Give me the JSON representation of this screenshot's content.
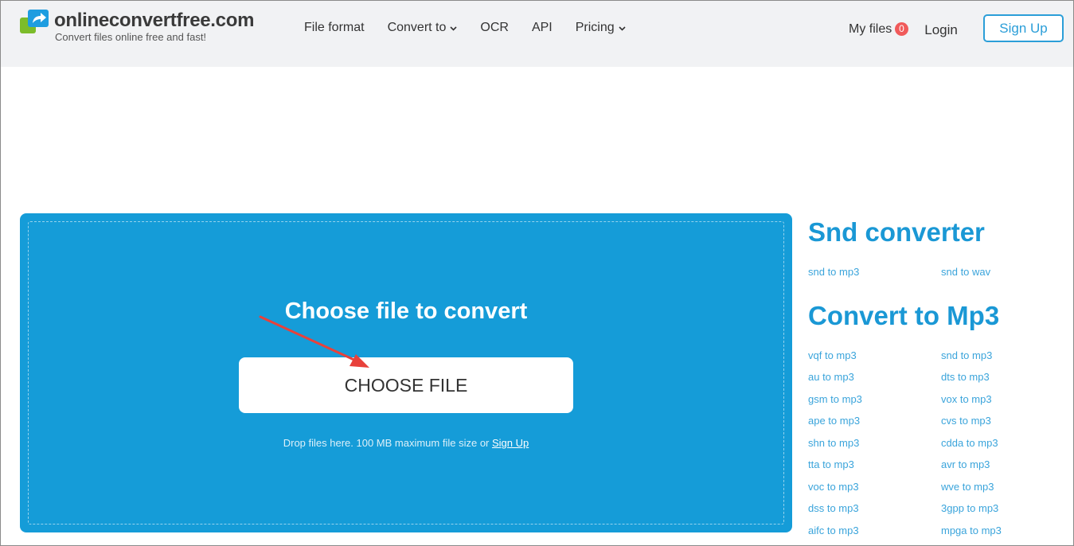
{
  "header": {
    "logo_title": "onlineconvertfree.com",
    "logo_subtitle": "Convert files online free and fast!",
    "nav": [
      {
        "label": "File format",
        "dropdown": false
      },
      {
        "label": "Convert to",
        "dropdown": true
      },
      {
        "label": "OCR",
        "dropdown": false
      },
      {
        "label": "API",
        "dropdown": false
      },
      {
        "label": "Pricing",
        "dropdown": true
      }
    ],
    "my_files_label": "My files",
    "my_files_count": "0",
    "login_label": "Login",
    "signup_label": "Sign Up"
  },
  "upload": {
    "title": "Choose file to convert",
    "button_label": "CHOOSE FILE",
    "drop_text": "Drop files here. 100 MB maximum file size or ",
    "drop_link": "Sign Up"
  },
  "sidebar": {
    "section1_title": "Snd converter",
    "section1_links": [
      "snd to mp3",
      "snd to wav"
    ],
    "section2_title": "Convert to Mp3",
    "section2_links": [
      "vqf to mp3",
      "snd to mp3",
      "au to mp3",
      "dts to mp3",
      "gsm to mp3",
      "vox to mp3",
      "ape to mp3",
      "cvs to mp3",
      "shn to mp3",
      "cdda to mp3",
      "tta to mp3",
      "avr to mp3",
      "voc to mp3",
      "wve to mp3",
      "dss to mp3",
      "3gpp to mp3",
      "aifc to mp3",
      "mpga to mp3"
    ]
  },
  "colors": {
    "accent": "#159cd8",
    "header_bg": "#f1f2f4",
    "badge": "#f05a5a",
    "annotation_arrow": "#e8413b"
  }
}
